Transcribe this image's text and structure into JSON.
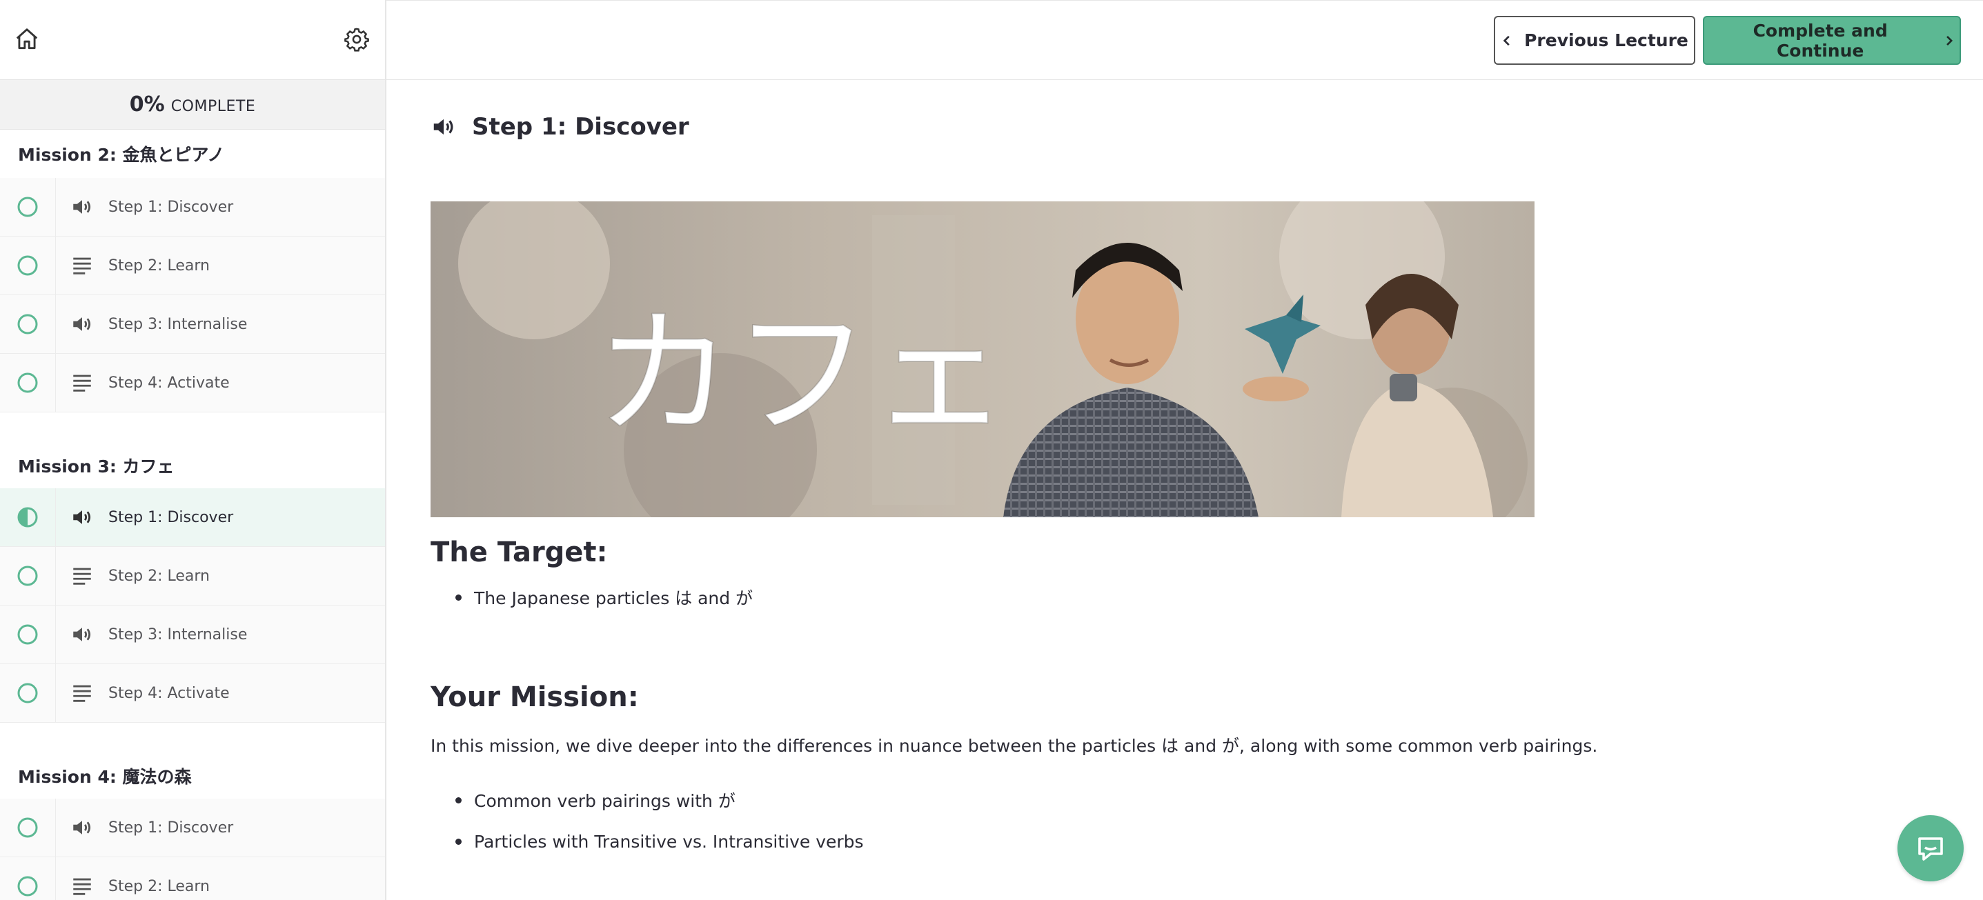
{
  "progress": {
    "percent": "0%",
    "label": "COMPLETE"
  },
  "sidebar": {
    "missions": [
      {
        "title": "Mission 2: 金魚とピアノ",
        "steps": [
          {
            "label": "Step 1: Discover",
            "icon": "speaker-icon",
            "status": "not-started"
          },
          {
            "label": "Step 2: Learn",
            "icon": "text-lines-icon",
            "status": "not-started"
          },
          {
            "label": "Step 3: Internalise",
            "icon": "speaker-icon",
            "status": "not-started"
          },
          {
            "label": "Step 4: Activate",
            "icon": "text-lines-icon",
            "status": "not-started"
          }
        ]
      },
      {
        "title": "Mission 3: カフェ",
        "steps": [
          {
            "label": "Step 1: Discover",
            "icon": "speaker-icon",
            "status": "in-progress"
          },
          {
            "label": "Step 2: Learn",
            "icon": "text-lines-icon",
            "status": "not-started"
          },
          {
            "label": "Step 3: Internalise",
            "icon": "speaker-icon",
            "status": "not-started"
          },
          {
            "label": "Step 4: Activate",
            "icon": "text-lines-icon",
            "status": "not-started"
          }
        ]
      },
      {
        "title": "Mission 4: 魔法の森",
        "steps": [
          {
            "label": "Step 1: Discover",
            "icon": "speaker-icon",
            "status": "not-started"
          },
          {
            "label": "Step 2: Learn",
            "icon": "text-lines-icon",
            "status": "not-started"
          }
        ]
      }
    ]
  },
  "toolbar": {
    "prev_label": "Previous Lecture",
    "next_label": "Complete and Continue"
  },
  "lecture": {
    "title": "Step 1: Discover",
    "hero_text": "カフェ",
    "target_heading": "The Target:",
    "target_items": [
      "The Japanese particles は and が"
    ],
    "mission_heading": "Your Mission:",
    "mission_text": "In this mission, we dive deeper into the differences in nuance between the particles は and が, along with some common verb pairings.",
    "mission_items": [
      "Common verb pairings with が",
      "Particles with Transitive vs. Intransitive verbs"
    ]
  },
  "colors": {
    "accent": "#5cb893",
    "accent_border": "#3c9b7a",
    "text": "#2b2b35",
    "muted": "#555559"
  }
}
